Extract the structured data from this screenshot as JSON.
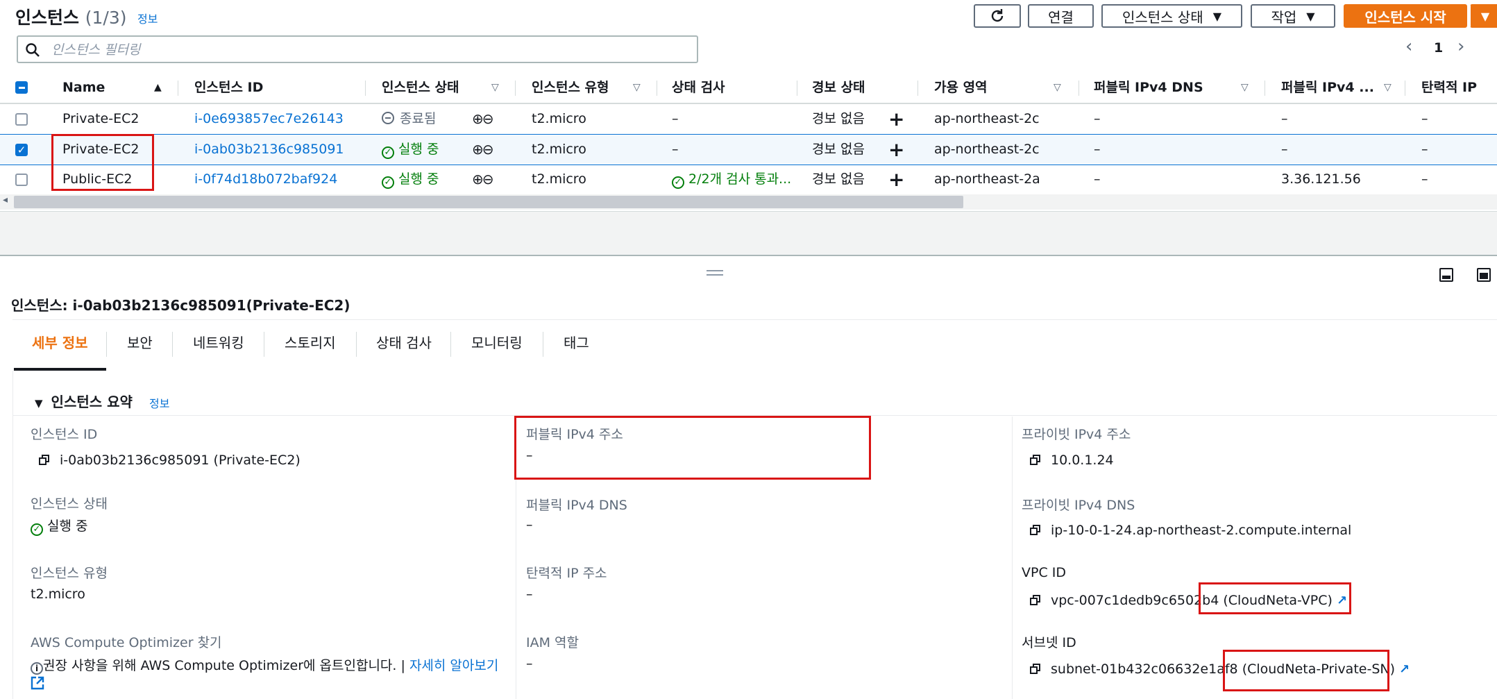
{
  "header": {
    "title": "인스턴스",
    "count": "(1/3)",
    "info_link": "정보",
    "buttons": {
      "connect": "연결",
      "instance_state": "인스턴스 상태",
      "actions": "작업",
      "launch": "인스턴스 시작"
    }
  },
  "search": {
    "placeholder": "인스턴스 필터링"
  },
  "pagination": {
    "page": "1"
  },
  "table": {
    "columns": [
      "Name",
      "인스턴스 ID",
      "인스턴스 상태",
      "인스턴스 유형",
      "상태 검사",
      "경보 상태",
      "가용 영역",
      "퍼블릭 IPv4 DNS",
      "퍼블릭 IPv4 ...",
      "탄력적 IP"
    ],
    "rows": [
      {
        "name": "Private-EC2",
        "id": "i-0e693857ec7e26143",
        "state": "종료됨",
        "type": "t2.micro",
        "check": "–",
        "alarm": "경보 없음",
        "az": "ap-northeast-2c",
        "dns": "–",
        "ip": "–",
        "eip": "–",
        "selected": false
      },
      {
        "name": "Private-EC2",
        "id": "i-0ab03b2136c985091",
        "state": "실행 중",
        "type": "t2.micro",
        "check": "–",
        "alarm": "경보 없음",
        "az": "ap-northeast-2c",
        "dns": "–",
        "ip": "–",
        "eip": "–",
        "selected": true
      },
      {
        "name": "Public-EC2",
        "id": "i-0f74d18b072baf924",
        "state": "실행 중",
        "type": "t2.micro",
        "check": "2/2개 검사 통과...",
        "alarm": "경보 없음",
        "az": "ap-northeast-2a",
        "dns": "–",
        "ip": "3.36.121.56",
        "eip": "–",
        "selected": false
      }
    ]
  },
  "detail": {
    "title": "인스턴스: i-0ab03b2136c985091(Private-EC2)",
    "tabs": [
      "세부 정보",
      "보안",
      "네트워킹",
      "스토리지",
      "상태 검사",
      "모니터링",
      "태그"
    ],
    "section": "인스턴스 요약",
    "section_info": "정보",
    "instance_id_label": "인스턴스 ID",
    "instance_id_value": "i-0ab03b2136c985091 (Private-EC2)",
    "instance_state_label": "인스턴스 상태",
    "instance_state_value": "실행 중",
    "instance_type_label": "인스턴스 유형",
    "instance_type_value": "t2.micro",
    "optimizer_label": "AWS Compute Optimizer 찾기",
    "optimizer_text": "권장 사항을 위해 AWS Compute Optimizer에 옵트인합니다. |",
    "optimizer_link": "자세히 알아보기",
    "public_ip_label": "퍼블릭 IPv4 주소",
    "public_ip_value": "–",
    "public_dns_label": "퍼블릭 IPv4 DNS",
    "public_dns_value": "–",
    "eip_label": "탄력적 IP 주소",
    "eip_value": "–",
    "iam_label": "IAM 역할",
    "iam_value": "–",
    "private_ip_label": "프라이빗 IPv4 주소",
    "private_ip_value": "10.0.1.24",
    "private_dns_label": "프라이빗 IPv4 DNS",
    "private_dns_value": "ip-10-0-1-24.ap-northeast-2.compute.internal",
    "vpc_label": "VPC ID",
    "vpc_id": "vpc-007c1dedb9c6502b4",
    "vpc_name": "(CloudNeta-VPC)",
    "subnet_label": "서브넷 ID",
    "subnet_id": "subnet-01b432c06632e1af8",
    "subnet_name": "(CloudNeta-Private-SN)"
  },
  "colors": {
    "accent": "#ec7211",
    "link": "#0972d3",
    "success": "#037f0c",
    "highlight": "#d91515"
  }
}
